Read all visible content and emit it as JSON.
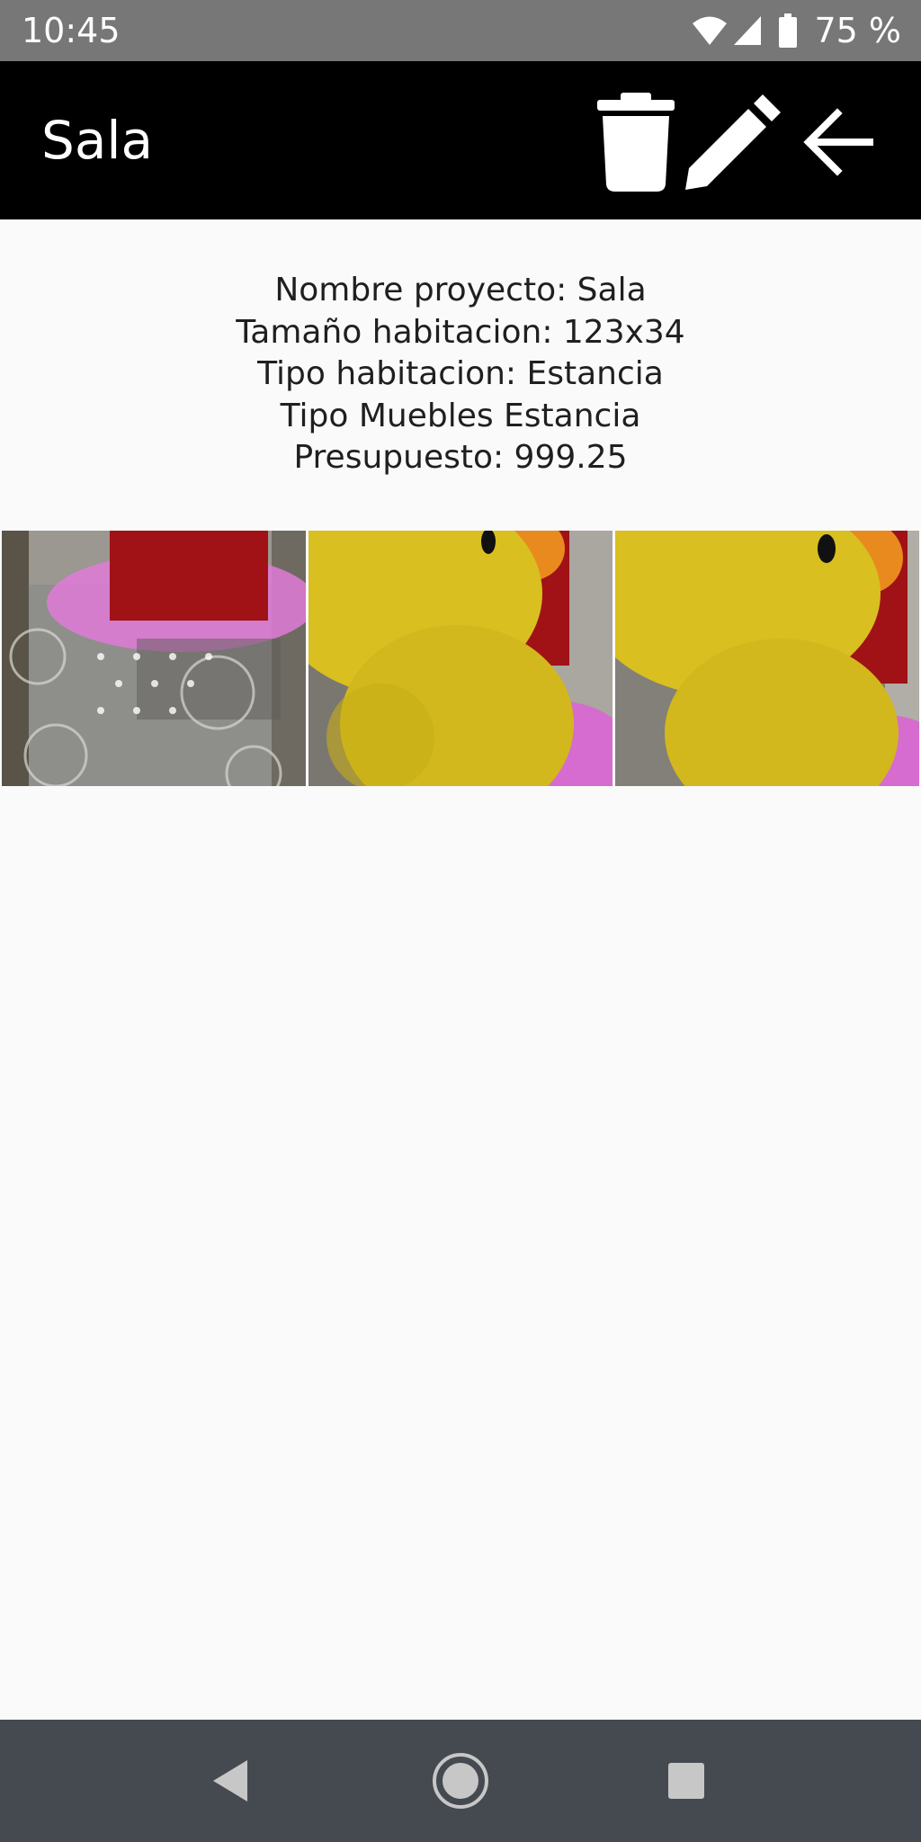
{
  "status_bar": {
    "time": "10:45",
    "battery_percent": "75 %",
    "icons": [
      "wifi-icon",
      "cell-signal-icon",
      "battery-icon"
    ]
  },
  "app_bar": {
    "title": "Sala",
    "actions": [
      "trash-icon",
      "pencil-icon",
      "arrow-left-icon"
    ]
  },
  "project_info": {
    "name_line": "Nombre proyecto: Sala",
    "size_line": "Tamaño habitacion: 123x34",
    "room_type_line": "Tipo habitacion: Estancia",
    "furniture_type_line": "Tipo Muebles Estancia",
    "budget_line": "Presupuesto: 999.25"
  },
  "gallery": {
    "photo_count": 3
  },
  "nav_bar": {
    "icons": [
      "back-triangle-icon",
      "home-circle-icon",
      "recents-square-icon"
    ]
  },
  "colors": {
    "status_bar_bg": "#777777",
    "app_bar_bg": "#000000",
    "page_bg": "#fafafa",
    "nav_bar_bg": "#444a50",
    "text": "#1f1f1f"
  }
}
